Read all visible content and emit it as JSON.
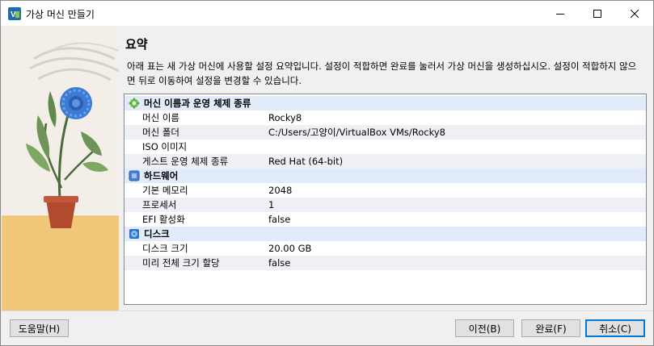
{
  "window": {
    "title": "가상 머신 만들기",
    "controls": {
      "minimize": "minimize",
      "maximize": "maximize",
      "close": "close"
    }
  },
  "page": {
    "heading": "요약",
    "description": "아래 표는 새 가상 머신에 사용할 설정 요약입니다. 설정이 적합하면 완료를 눌러서 가상 머신을 생성하십시오. 설정이 적합하지 않으면 뒤로 이동하여 설정을 변경할 수 있습니다."
  },
  "summary": {
    "sections": [
      {
        "title": "머신 이름과 운영 체제 종류",
        "icon": "vm-gear-icon",
        "rows": [
          {
            "key": "머신 이름",
            "value": "Rocky8"
          },
          {
            "key": "머신 폴더",
            "value": "C:/Users/고양이/VirtualBox VMs/Rocky8"
          },
          {
            "key": "ISO 이미지",
            "value": ""
          },
          {
            "key": "게스트 운영 체제 종류",
            "value": "Red Hat (64-bit)"
          }
        ]
      },
      {
        "title": "하드웨어",
        "icon": "chip-icon",
        "rows": [
          {
            "key": "기본 메모리",
            "value": "2048"
          },
          {
            "key": "프로세서",
            "value": "1"
          },
          {
            "key": "EFI 활성화",
            "value": "false"
          }
        ]
      },
      {
        "title": "디스크",
        "icon": "disk-icon",
        "rows": [
          {
            "key": "디스크 크기",
            "value": "20.00 GB"
          },
          {
            "key": "미리 전체 크기 할당",
            "value": "false"
          }
        ]
      }
    ]
  },
  "footer": {
    "help": "도움말(H)",
    "back": "이전(B)",
    "finish": "완료(F)",
    "cancel": "취소(C)"
  },
  "colors": {
    "accent": "#0078d7",
    "section_bg": "#e1ebf9",
    "alt_row_bg": "#eef0f6"
  }
}
